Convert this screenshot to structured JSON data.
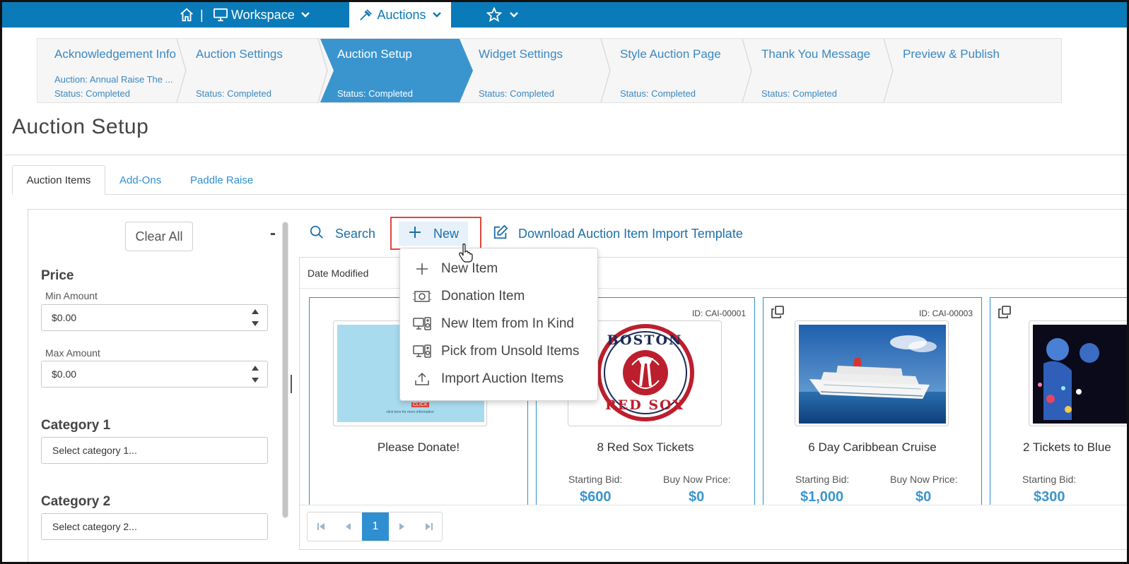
{
  "topbar": {
    "home_sep": "|",
    "workspace_label": "Workspace",
    "auctions_label": "Auctions"
  },
  "wizard": {
    "steps": [
      {
        "title": "Acknowledgement Info",
        "sub": "Auction: Annual Raise The ...",
        "status": "Status: Completed"
      },
      {
        "title": "Auction Settings",
        "sub": "",
        "status": "Status: Completed"
      },
      {
        "title": "Auction Setup",
        "sub": "",
        "status": "Status: Completed"
      },
      {
        "title": "Widget Settings",
        "sub": "",
        "status": "Status: Completed"
      },
      {
        "title": "Style Auction Page",
        "sub": "",
        "status": "Status: Completed"
      },
      {
        "title": "Thank You Message",
        "sub": "",
        "status": "Status: Completed"
      },
      {
        "title": "Preview & Publish",
        "sub": "",
        "status": ""
      }
    ],
    "active_step": "Auction Setup"
  },
  "page": {
    "title": "Auction Setup"
  },
  "tabs": [
    {
      "label": "Auction Items"
    },
    {
      "label": "Add-Ons"
    },
    {
      "label": "Paddle Raise"
    }
  ],
  "filters": {
    "clear_all": "Clear All",
    "collapse": "-",
    "price_label": "Price",
    "min_label": "Min Amount",
    "min_value": "$0.00",
    "max_label": "Max Amount",
    "max_value": "$0.00",
    "cat1_label": "Category 1",
    "cat1_placeholder": "Select category 1...",
    "cat2_label": "Category 2",
    "cat2_placeholder": "Select category 2..."
  },
  "toolbar": {
    "search_label": "Search",
    "new_label": "New",
    "download_label": "Download Auction Item Import Template"
  },
  "new_menu": {
    "items": [
      {
        "label": "New Item",
        "icon": "plus-icon"
      },
      {
        "label": "Donation Item",
        "icon": "cash-icon"
      },
      {
        "label": "New Item from In Kind",
        "icon": "monitor-speaker-icon"
      },
      {
        "label": "Pick from Unsold Items",
        "icon": "monitor-speaker-icon"
      },
      {
        "label": "Import Auction Items",
        "icon": "upload-icon"
      }
    ]
  },
  "grid": {
    "sort_label": "Date Modified",
    "cards": [
      {
        "name": "Please Donate!",
        "id": "",
        "starting_bid_label": "",
        "starting_bid": "",
        "buy_now_label": "",
        "buy_now": "",
        "image_caption": "CLICK",
        "image_sub": "click here for more information"
      },
      {
        "name": "8 Red Sox Tickets",
        "id": "ID: CAI-00001",
        "starting_bid_label": "Starting Bid:",
        "starting_bid": "$600",
        "buy_now_label": "Buy Now Price:",
        "buy_now": "$0",
        "logo_top": "BOSTON",
        "logo_bottom": "RED SOX"
      },
      {
        "name": "6 Day Caribbean Cruise",
        "id": "ID: CAI-00003",
        "starting_bid_label": "Starting Bid:",
        "starting_bid": "$1,000",
        "buy_now_label": "Buy Now Price:",
        "buy_now": "$0"
      },
      {
        "name": "2 Tickets to Blue",
        "id": "",
        "starting_bid_label": "Starting Bid:",
        "starting_bid": "$300",
        "buy_now_label": "",
        "buy_now": ""
      }
    ]
  },
  "pager": {
    "current_page": "1"
  },
  "colors": {
    "topbar": "#0b7ab8",
    "accent": "#2f8fd0",
    "active_step": "#3a95cf",
    "highlight_border": "#e0473a"
  }
}
